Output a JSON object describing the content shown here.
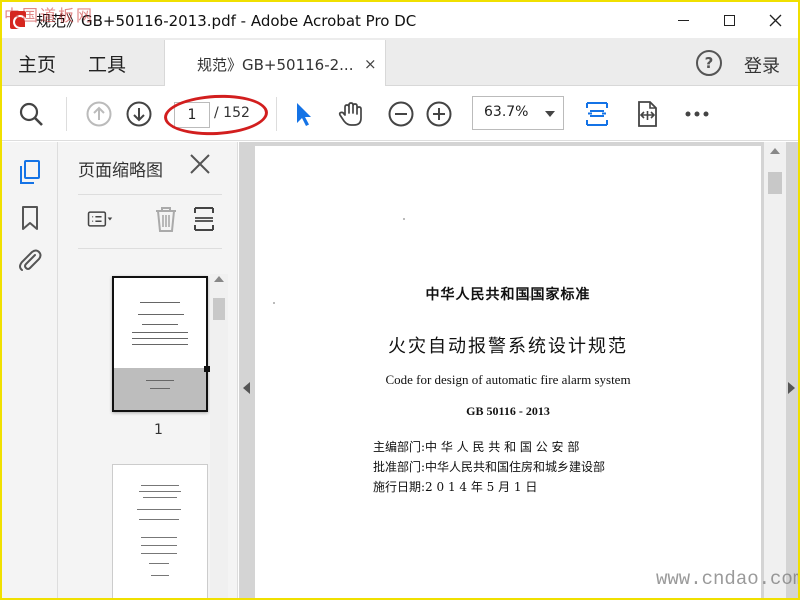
{
  "window": {
    "title": "规范》GB+50116-2013.pdf - Adobe Acrobat Pro DC"
  },
  "menubar": {
    "home": "主页",
    "tools": "工具",
    "doc_tab": "规范》GB+50116-2...",
    "doc_tab_close": "×",
    "help": "?",
    "login": "登录"
  },
  "toolbar": {
    "page_current": "1",
    "page_total": "/ 152",
    "zoom": "63.7%",
    "icons": [
      "search-icon",
      "arrow-up-icon",
      "arrow-down-icon",
      "select-arrow-icon",
      "hand-icon",
      "zoom-out-icon",
      "zoom-in-icon",
      "fit-page-icon",
      "fit-width-icon",
      "more-icon"
    ],
    "annotation_color": "#d21e1e"
  },
  "sidebar": {
    "icons": [
      "page-thumbnails-icon",
      "bookmark-icon",
      "attachment-icon"
    ],
    "active_color": "#1473e6"
  },
  "thumbnails": {
    "title": "页面缩略图",
    "pages": [
      {
        "label": "1"
      }
    ]
  },
  "document": {
    "standard": "中华人民共和国国家标准",
    "title": "火灾自动报警系统设计规范",
    "title_en": "Code for design of automatic fire alarm system",
    "code": "GB 50116 - 2013",
    "chief": "主编部门:中 华 人 民 共 和 国 公 安 部",
    "approver": "批准部门:中华人民共和国住房和城乡建设部",
    "effective": "施行日期:2 0 1 4 年 5 月 1 日"
  },
  "watermarks": {
    "top_left": "中国道板网",
    "bottom_right": "www.cndao.com"
  }
}
